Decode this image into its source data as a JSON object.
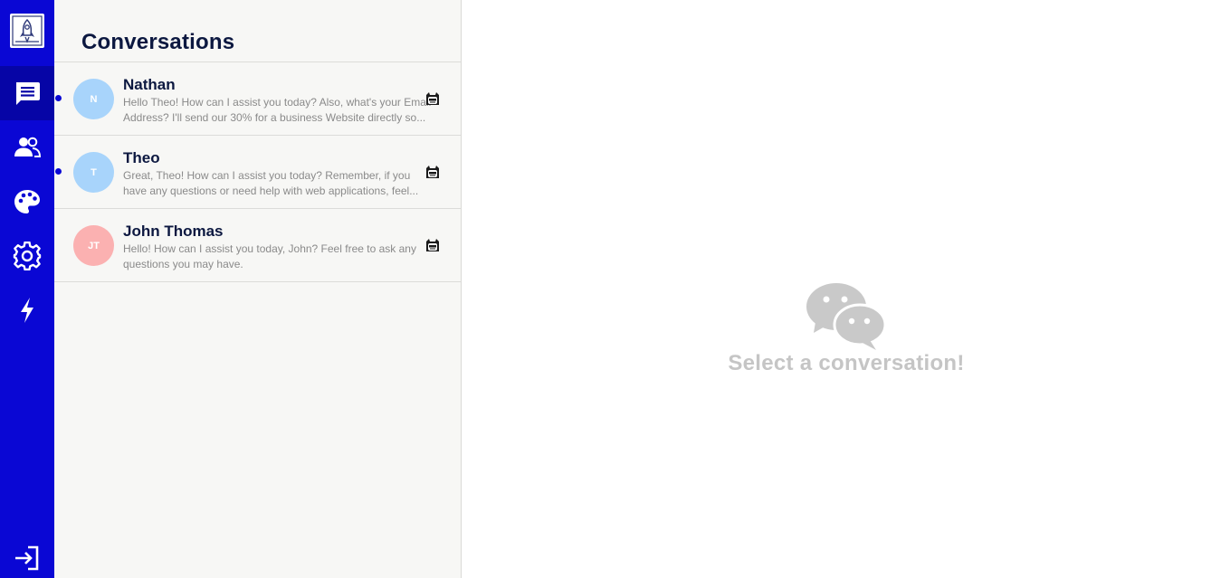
{
  "nav": {
    "logo_icon": "rocket-logo-icon",
    "items": [
      {
        "name": "chat",
        "icon": "chat-bubble-icon",
        "active": true
      },
      {
        "name": "contacts",
        "icon": "users-icon",
        "active": false
      },
      {
        "name": "theme",
        "icon": "palette-icon",
        "active": false
      },
      {
        "name": "settings",
        "icon": "gear-icon",
        "active": false
      },
      {
        "name": "automation",
        "icon": "lightning-bolt-icon",
        "active": false
      }
    ],
    "logout_icon": "sign-in-arrow-icon"
  },
  "conversations": {
    "title": "Conversations",
    "items": [
      {
        "name": "Nathan",
        "initials": "N",
        "avatar_color": "#a8d4fb",
        "unread": true,
        "preview": "Hello Theo! How can I assist you today? Also, what's your Email Address? I'll send our 30% for a business Website directly so...",
        "badge_icon": "bot-badge-icon"
      },
      {
        "name": "Theo",
        "initials": "T",
        "avatar_color": "#a8d4fb",
        "unread": true,
        "preview": "Great, Theo! How can I assist you today? Remember, if you have any questions or need help with web applications, feel...",
        "badge_icon": "bot-badge-icon"
      },
      {
        "name": "John Thomas",
        "initials": "JT",
        "avatar_color": "#fbb1b1",
        "unread": false,
        "preview": "Hello! How can I assist you today, John? Feel free to ask any questions you may have.",
        "badge_icon": "bot-badge-icon"
      }
    ]
  },
  "main": {
    "empty_icon": "wechat-bubbles-icon",
    "empty_text": "Select a conversation!"
  },
  "colors": {
    "rail": "#0a07d4",
    "rail_active": "#0605a6",
    "title": "#0c1840",
    "muted": "#c5c5c5"
  }
}
